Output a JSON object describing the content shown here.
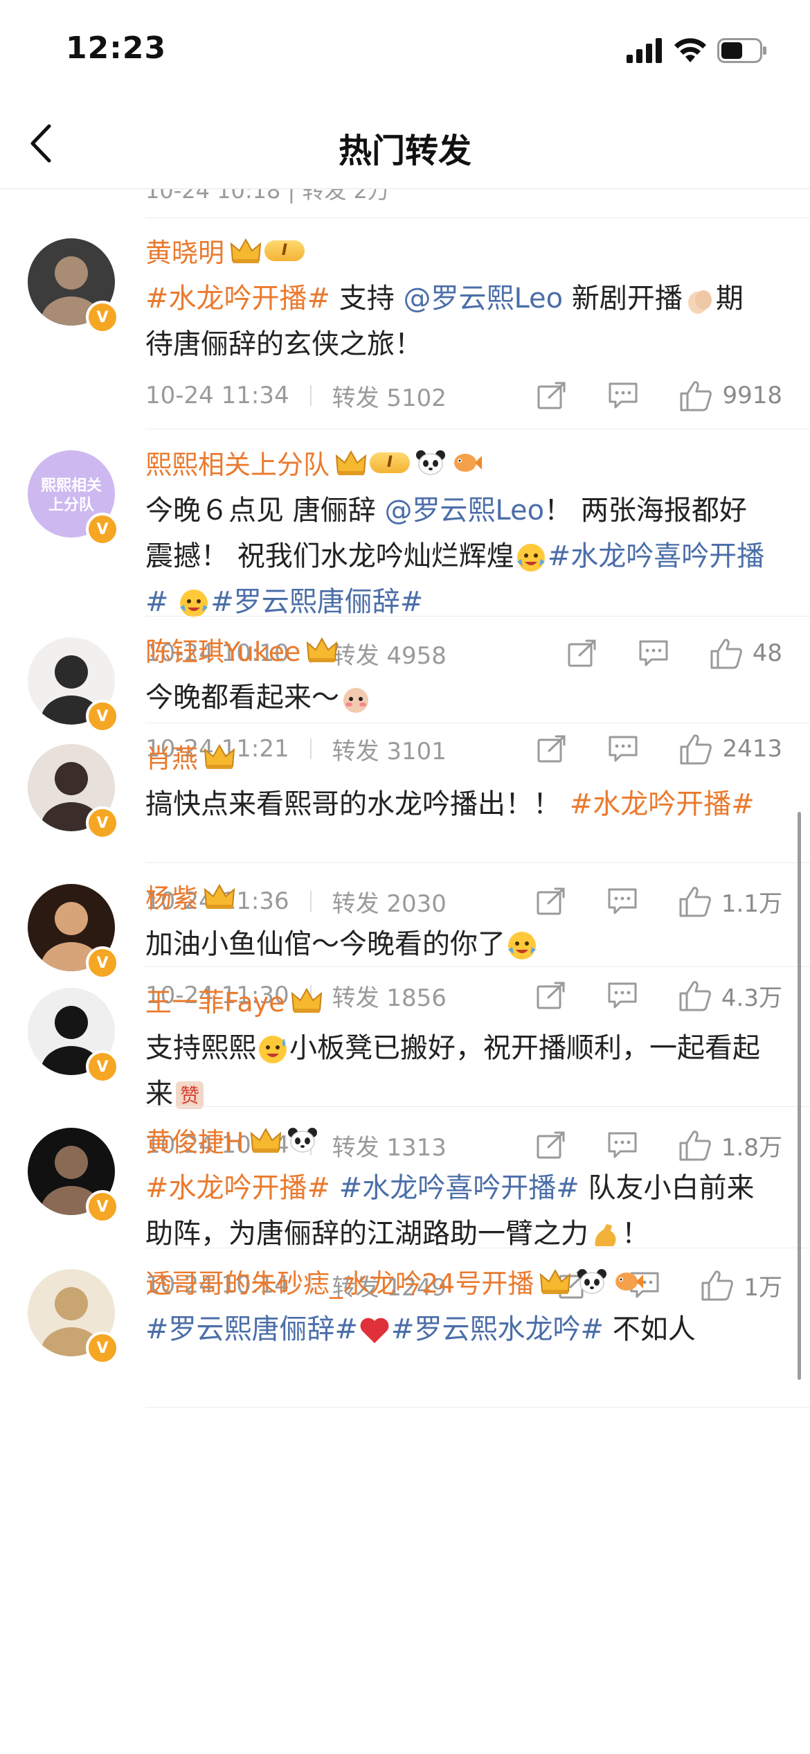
{
  "status": {
    "time": "12:23"
  },
  "nav": {
    "title": "热门转发"
  },
  "partial_top": {
    "text": "10-24 10:18  |  转发 2万"
  },
  "items": [
    {
      "name": "黄晓明",
      "badges": [
        "crown-level-icon"
      ],
      "content": [
        {
          "t": "tag",
          "v": "#水龙吟开播#"
        },
        {
          "t": "text",
          "v": " 支持 "
        },
        {
          "t": "mention",
          "v": "@罗云熙Leo"
        },
        {
          "t": "text",
          "v": " 新剧开播"
        },
        {
          "t": "emoji",
          "v": "clap-emoji"
        },
        {
          "t": "text",
          "v": "期待唐俪辞的玄侠之旅！"
        }
      ],
      "time": "10-24 11:34",
      "repost": "转发 5102",
      "likes": "9918"
    },
    {
      "name": "熙熙相关上分队",
      "avatar_text": "熙熙相关上分队",
      "badges": [
        "crown-level-icon",
        "panda-icon",
        "fish-icon"
      ],
      "content": [
        {
          "t": "text",
          "v": "今晚６点见 唐俪辞 "
        },
        {
          "t": "mention",
          "v": "@罗云熙Leo"
        },
        {
          "t": "text",
          "v": "！ 两张海报都好震撼！ 祝我们水龙吟灿烂辉煌"
        },
        {
          "t": "emoji",
          "v": "cheer-emoji"
        },
        {
          "t": "tag2",
          "v": "#水龙吟喜吟开播#"
        },
        {
          "t": "text",
          "v": " "
        },
        {
          "t": "emoji",
          "v": "cheer-emoji"
        },
        {
          "t": "tag2",
          "v": "#罗云熙唐俪辞#"
        }
      ],
      "time": "10-24 10:10",
      "repost": "转发 4958",
      "likes": "48"
    },
    {
      "name": "陈钰琪Yukee",
      "badges": [
        "crown-icon"
      ],
      "content": [
        {
          "t": "text",
          "v": "今晚都看起来～"
        },
        {
          "t": "emoji",
          "v": "shy-emoji"
        }
      ],
      "time": "10-24 11:21",
      "repost": "转发 3101",
      "likes": "2413"
    },
    {
      "name": "肖燕",
      "badges": [
        "crown-icon"
      ],
      "content": [
        {
          "t": "text",
          "v": "搞快点来看熙哥的水龙吟播出！！ "
        },
        {
          "t": "tag",
          "v": "#水龙吟开播#"
        }
      ],
      "time": "10-24 11:36",
      "repost": "转发 2030",
      "likes": "1.1万"
    },
    {
      "name": "杨紫",
      "badges": [
        "crown-icon"
      ],
      "content": [
        {
          "t": "text",
          "v": "加油小鱼仙倌～今晚看的你了"
        },
        {
          "t": "emoji",
          "v": "cheer-emoji"
        }
      ],
      "time": "10-24 11:30",
      "repost": "转发 1856",
      "likes": "4.3万"
    },
    {
      "name": "王一菲Faye",
      "badges": [
        "crown-icon"
      ],
      "content": [
        {
          "t": "text",
          "v": "支持熙熙"
        },
        {
          "t": "emoji",
          "v": "sweat-emoji"
        },
        {
          "t": "text",
          "v": "小板凳已搬好，祝开播顺利，一起看起来"
        },
        {
          "t": "emoji",
          "v": "zan-emoji"
        }
      ],
      "time": "10-24 10:14",
      "repost": "转发 1313",
      "likes": "1.8万"
    },
    {
      "name": "黄俊捷H",
      "badges": [
        "crown-icon",
        "panda-icon"
      ],
      "content": [
        {
          "t": "tag",
          "v": "#水龙吟开播#"
        },
        {
          "t": "text",
          "v": " "
        },
        {
          "t": "tag2",
          "v": "#水龙吟喜吟开播#"
        },
        {
          "t": "text",
          "v": " 队友小白前来助阵，为唐俪辞的江湖路助一臂之力"
        },
        {
          "t": "emoji",
          "v": "muscle-emoji"
        },
        {
          "t": "text",
          "v": "！"
        }
      ],
      "time": "10-24 10:14",
      "repost": "转发 1249",
      "likes": "1万"
    },
    {
      "name": "透哥哥的朱砂痣_水龙吟24号开播",
      "badges": [
        "crown-icon",
        "panda-icon",
        "fish-icon"
      ],
      "content": [
        {
          "t": "tag2",
          "v": "#罗云熙唐俪辞#"
        },
        {
          "t": "emoji",
          "v": "heart-emoji"
        },
        {
          "t": "tag2",
          "v": "#罗云熙水龙吟#"
        },
        {
          "t": "text",
          "v": " 不如人"
        }
      ],
      "time": "",
      "repost": "",
      "likes": ""
    }
  ],
  "colors": {
    "accent": "#ea7a2e",
    "mention": "#4b6ea8",
    "meta": "#9a9a9a",
    "badge": "#f5a623"
  }
}
